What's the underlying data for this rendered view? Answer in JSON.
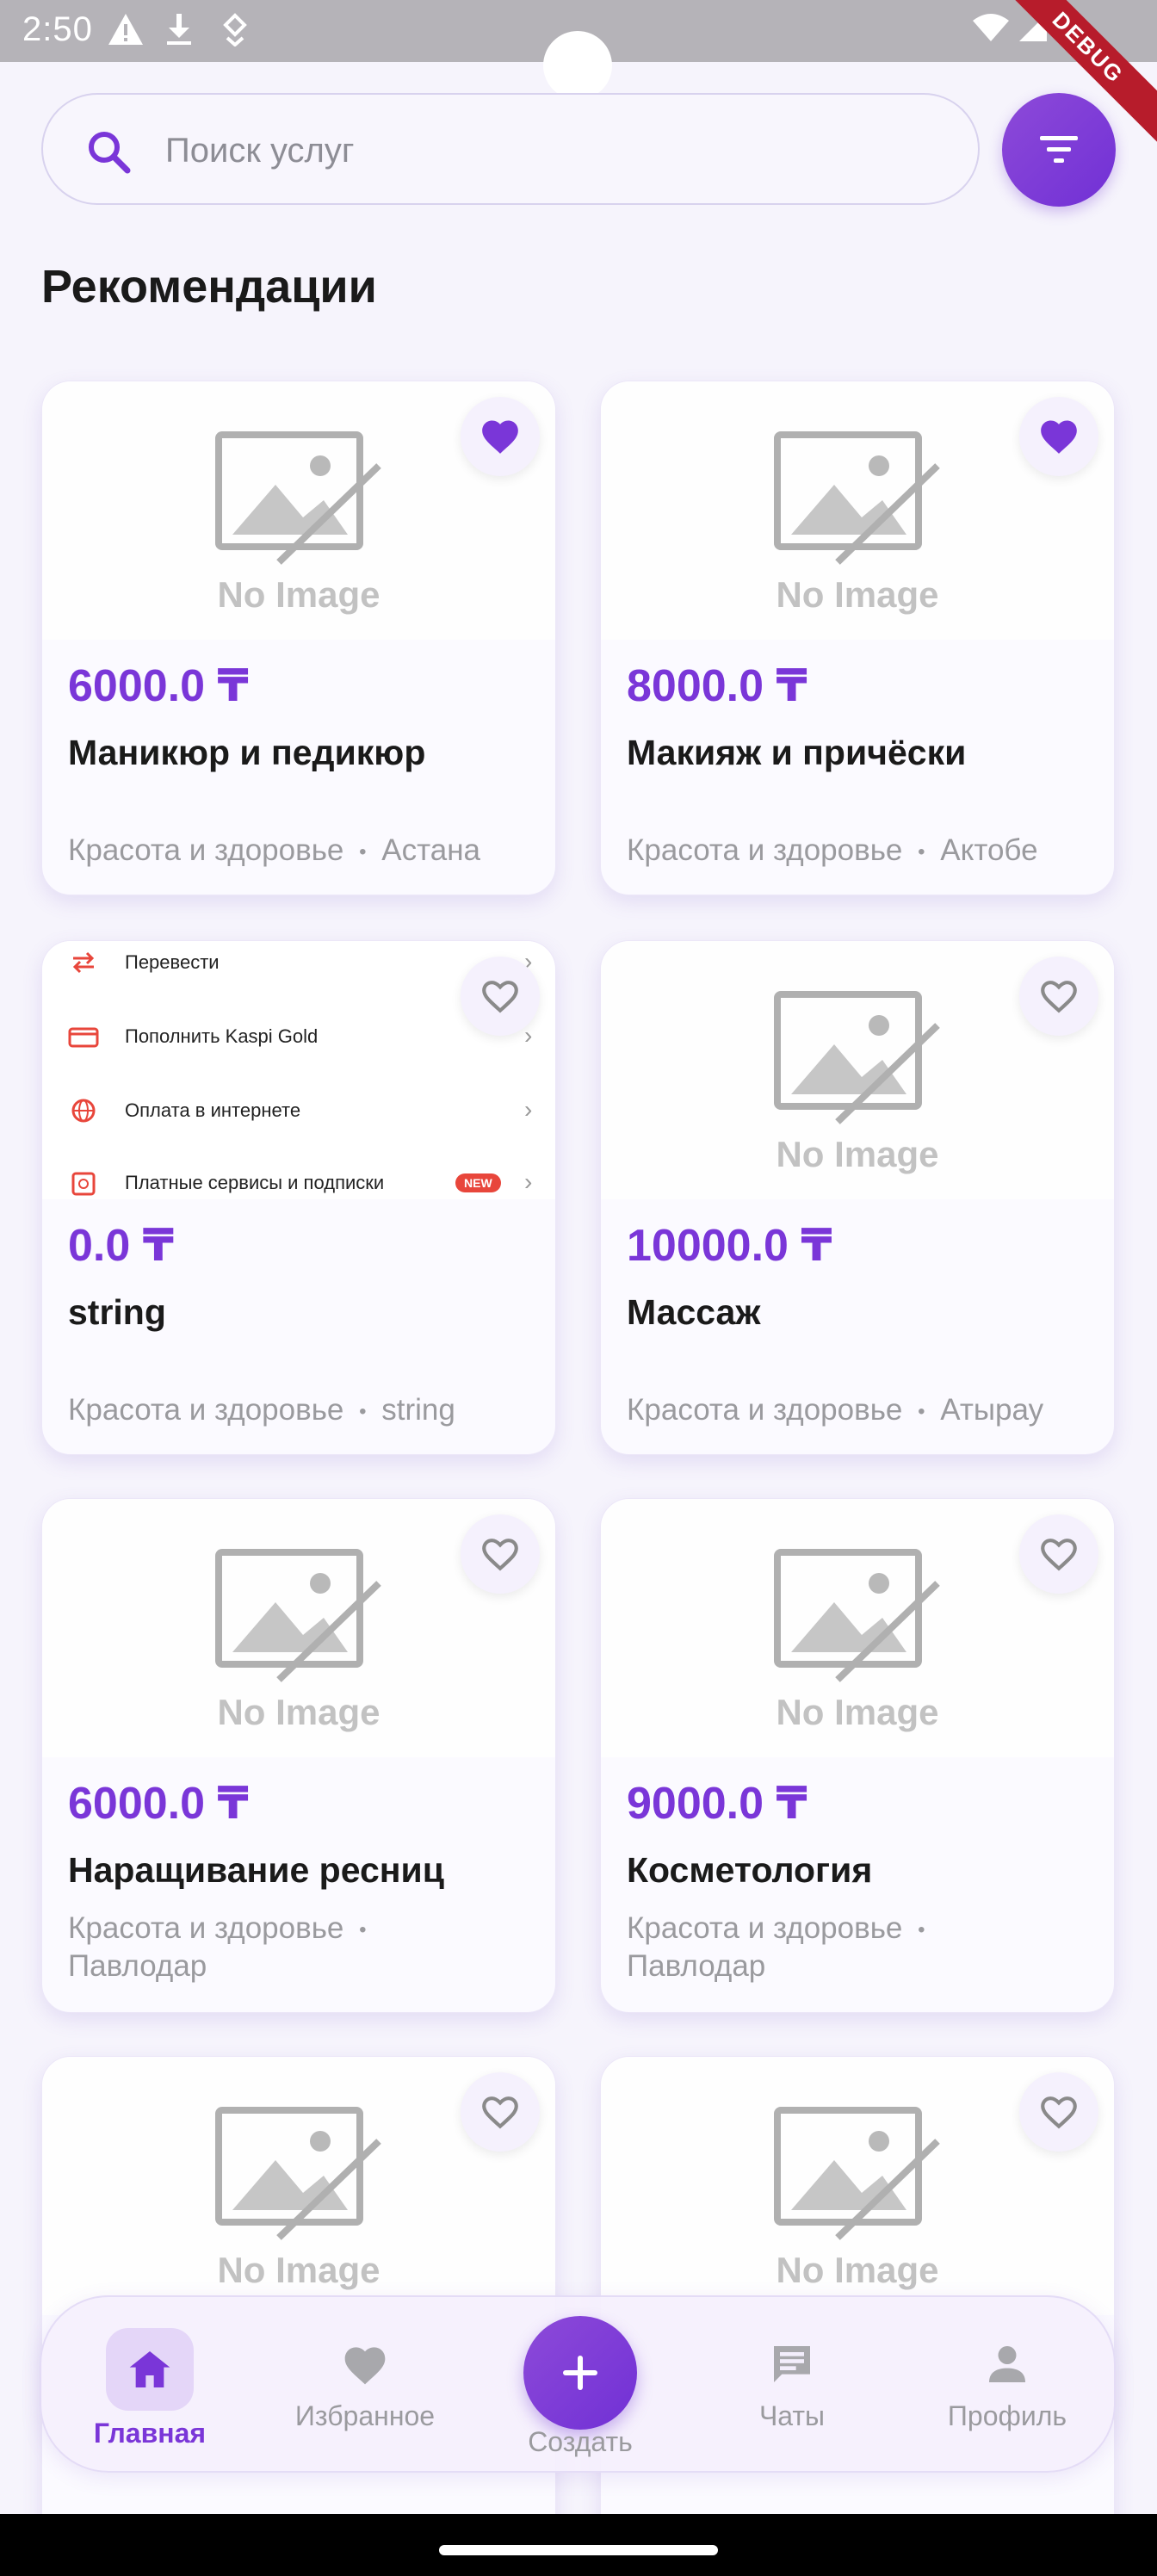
{
  "status_bar": {
    "time": "2:50",
    "debug_label": "DEBUG"
  },
  "search": {
    "placeholder": "Поиск услуг"
  },
  "section": {
    "title": "Рекомендации"
  },
  "colors": {
    "accent": "#7a36d8",
    "background": "#f6f4fc",
    "muted": "#9a9a9e"
  },
  "placeholder_image_text": "No Image",
  "cards": [
    {
      "price": "6000.0 ₸",
      "title": "Маникюр и педикюр",
      "category": "Красота и здоровье",
      "separator": "•",
      "city": "Астана",
      "favorite": true
    },
    {
      "price": "8000.0 ₸",
      "title": "Макияж и причёски",
      "category": "Красота и здоровье",
      "separator": "•",
      "city": "Актобе",
      "favorite": true
    },
    {
      "price": "0.0 ₸",
      "title": "string",
      "category": "Красота и здоровье",
      "separator": "•",
      "city": "string",
      "favorite": false,
      "screenshot_rows": [
        "Перевести",
        "Пополнить Kaspi Gold",
        "Оплата в интернете",
        "Платные сервисы и подписки"
      ],
      "screenshot_badge": "NEW"
    },
    {
      "price": "10000.0 ₸",
      "title": "Массаж",
      "category": "Красота и здоровье",
      "separator": "•",
      "city": "Атырау",
      "favorite": false
    },
    {
      "price": "6000.0 ₸",
      "title": "Наращивание ресниц",
      "category": "Красота и здоровье",
      "separator": "•",
      "city": "Павлодар",
      "favorite": false
    },
    {
      "price": "9000.0 ₸",
      "title": "Косметология",
      "category": "Красота и здоровье",
      "separator": "•",
      "city": "Павлодар",
      "favorite": false
    },
    {
      "favorite": false
    },
    {
      "favorite": false
    }
  ],
  "bottom_nav": {
    "home": "Главная",
    "favorites": "Избранное",
    "create": "Создать",
    "chats": "Чаты",
    "profile": "Профиль"
  }
}
